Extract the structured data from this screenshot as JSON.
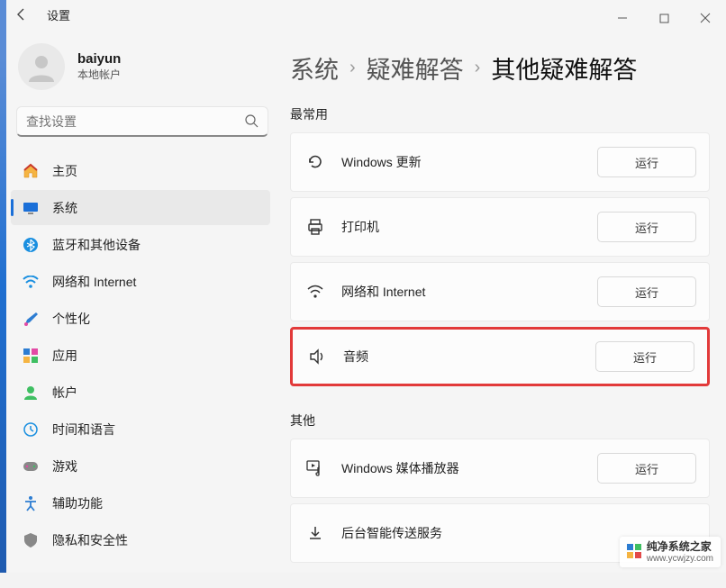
{
  "title": "设置",
  "user": {
    "name": "baiyun",
    "subtitle": "本地帐户"
  },
  "search": {
    "placeholder": "查找设置"
  },
  "nav": {
    "items": [
      {
        "label": "主页"
      },
      {
        "label": "系统"
      },
      {
        "label": "蓝牙和其他设备"
      },
      {
        "label": "网络和 Internet"
      },
      {
        "label": "个性化"
      },
      {
        "label": "应用"
      },
      {
        "label": "帐户"
      },
      {
        "label": "时间和语言"
      },
      {
        "label": "游戏"
      },
      {
        "label": "辅助功能"
      },
      {
        "label": "隐私和安全性"
      }
    ]
  },
  "breadcrumb": {
    "a": "系统",
    "b": "疑难解答",
    "c": "其他疑难解答"
  },
  "sections": {
    "frequent": {
      "title": "最常用",
      "items": [
        {
          "label": "Windows 更新",
          "button": "运行"
        },
        {
          "label": "打印机",
          "button": "运行"
        },
        {
          "label": "网络和 Internet",
          "button": "运行"
        },
        {
          "label": "音频",
          "button": "运行"
        }
      ]
    },
    "other": {
      "title": "其他",
      "items": [
        {
          "label": "Windows 媒体播放器",
          "button": "运行"
        },
        {
          "label": "后台智能传送服务",
          "button": ""
        }
      ]
    }
  },
  "watermark": {
    "brand": "纯净系统之家",
    "url": "www.ycwjzy.com"
  }
}
